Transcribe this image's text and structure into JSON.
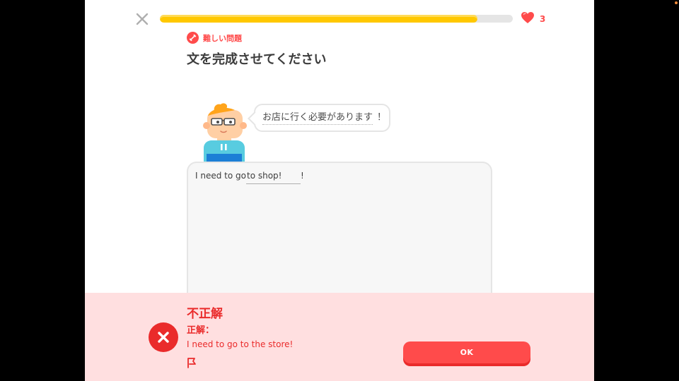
{
  "header": {
    "progress_fraction": 0.9,
    "hearts_count": "3",
    "hard_label": "難しい問題"
  },
  "prompt": {
    "title": "文を完成させてください",
    "bubble_text": "お店に行く必要があります",
    "bubble_punct": "！"
  },
  "exercise": {
    "sentence_before": "I need to go",
    "input_value": "to shop!",
    "sentence_after": "!"
  },
  "feedback": {
    "title": "不正解",
    "subtitle": "正解：",
    "correct_answer": "I need to go to the store!",
    "ok_label": "OK"
  },
  "colors": {
    "progress": "#ffc800",
    "error_red": "#ea2b2b",
    "button_red": "#ff4b4b",
    "feedback_bg": "#ffdfe0"
  },
  "icons": {
    "close": "close-icon",
    "heart": "heart-icon",
    "hard": "dumbbell-icon",
    "incorrect": "x-icon",
    "report": "flag-icon"
  }
}
